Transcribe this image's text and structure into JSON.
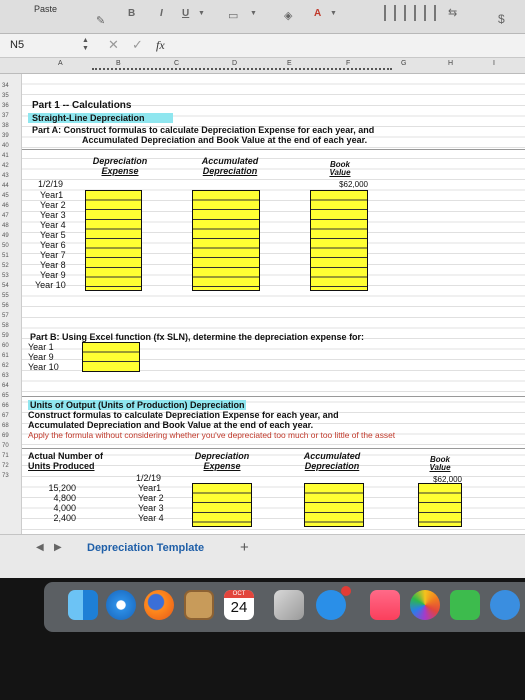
{
  "ribbon": {
    "paste_label": "Paste",
    "bold_label": "B",
    "italic_label": "I",
    "underline_label": "U",
    "font_color_label": "A",
    "currency_label": "$",
    "fill_icon": "paint-bucket-icon",
    "wrap_icon": "wrap-icon"
  },
  "formula_bar": {
    "name_box": "N5",
    "stepper_up": "▲",
    "stepper_down": "▼",
    "cancel": "✕",
    "confirm": "✓",
    "fx": "fx",
    "value": ""
  },
  "columns": [
    "A",
    "B",
    "C",
    "D",
    "E",
    "F",
    "G",
    "H",
    "I"
  ],
  "row_numbers": [
    "34",
    "35",
    "36",
    "37",
    "38",
    "39",
    "40",
    "41",
    "42",
    "43",
    "44",
    "45",
    "46",
    "47",
    "48",
    "49",
    "50",
    "51",
    "52",
    "53",
    "54",
    "55",
    "56",
    "57",
    "58",
    "59",
    "60",
    "61",
    "62",
    "63",
    "64",
    "65",
    "66",
    "67",
    "68",
    "69",
    "70",
    "71",
    "72",
    "73"
  ],
  "part1": {
    "title": "Part 1 -- Calculations",
    "section": "Straight-Line Depreciation",
    "part_a_line1": "Part A: Construct formulas to calculate Depreciation Expense for each year, and",
    "part_a_line2": "Accumulated Depreciation and Book Value at the end of each year.",
    "col_dep_1": "Depreciation",
    "col_dep_2": "Expense",
    "col_acc_1": "Accumulated",
    "col_acc_2": "Depreciation",
    "col_book_1": "Book",
    "col_book_2": "Value",
    "start_date": "1/2/19",
    "start_book_value": "$62,000",
    "years": [
      "Year1",
      "Year 2",
      "Year 3",
      "Year 4",
      "Year 5",
      "Year 6",
      "Year 7",
      "Year 8",
      "Year 9",
      "Year 10"
    ]
  },
  "part_b": {
    "title": "Part B: Using Excel function (fx SLN), determine the depreciation expense for:",
    "years": [
      "Year 1",
      "Year 9",
      "Year 10"
    ]
  },
  "units": {
    "section": "Units of Output (Units of Production) Depreciation",
    "line1": "Construct formulas to calculate Depreciation Expense for each year, and",
    "line2": "Accumulated Depreciation and Book Value at the end of each year.",
    "line3": "Apply the formula without considering whether you've depreciated too much or too little of the asset",
    "col_actual_1": "Actual Number of",
    "col_actual_2": "Units Produced",
    "col_dep_1": "Depreciation",
    "col_dep_2": "Expense",
    "col_acc_1": "Accumulated",
    "col_acc_2": "Depreciation",
    "col_book_1": "Book",
    "col_book_2": "Value",
    "start_date": "1/2/19",
    "start_book_value": "$62,000",
    "units": [
      "15,200",
      "4,800",
      "4,000",
      "2,400"
    ],
    "years": [
      "Year1",
      "Year 2",
      "Year 3",
      "Year 4"
    ]
  },
  "tabs": {
    "prev": "◀",
    "next": "▶",
    "sheet_name": "Depreciation Template",
    "add": "+"
  },
  "dock": {
    "calendar_month": "OCT",
    "calendar_day": "24",
    "icons": [
      "finder-icon",
      "safari-icon",
      "firefox-icon",
      "notes-icon",
      "calendar-icon",
      "stamp-icon",
      "app-store-icon",
      "music-icon",
      "photos-icon",
      "facetime-icon",
      "more-icon"
    ]
  }
}
